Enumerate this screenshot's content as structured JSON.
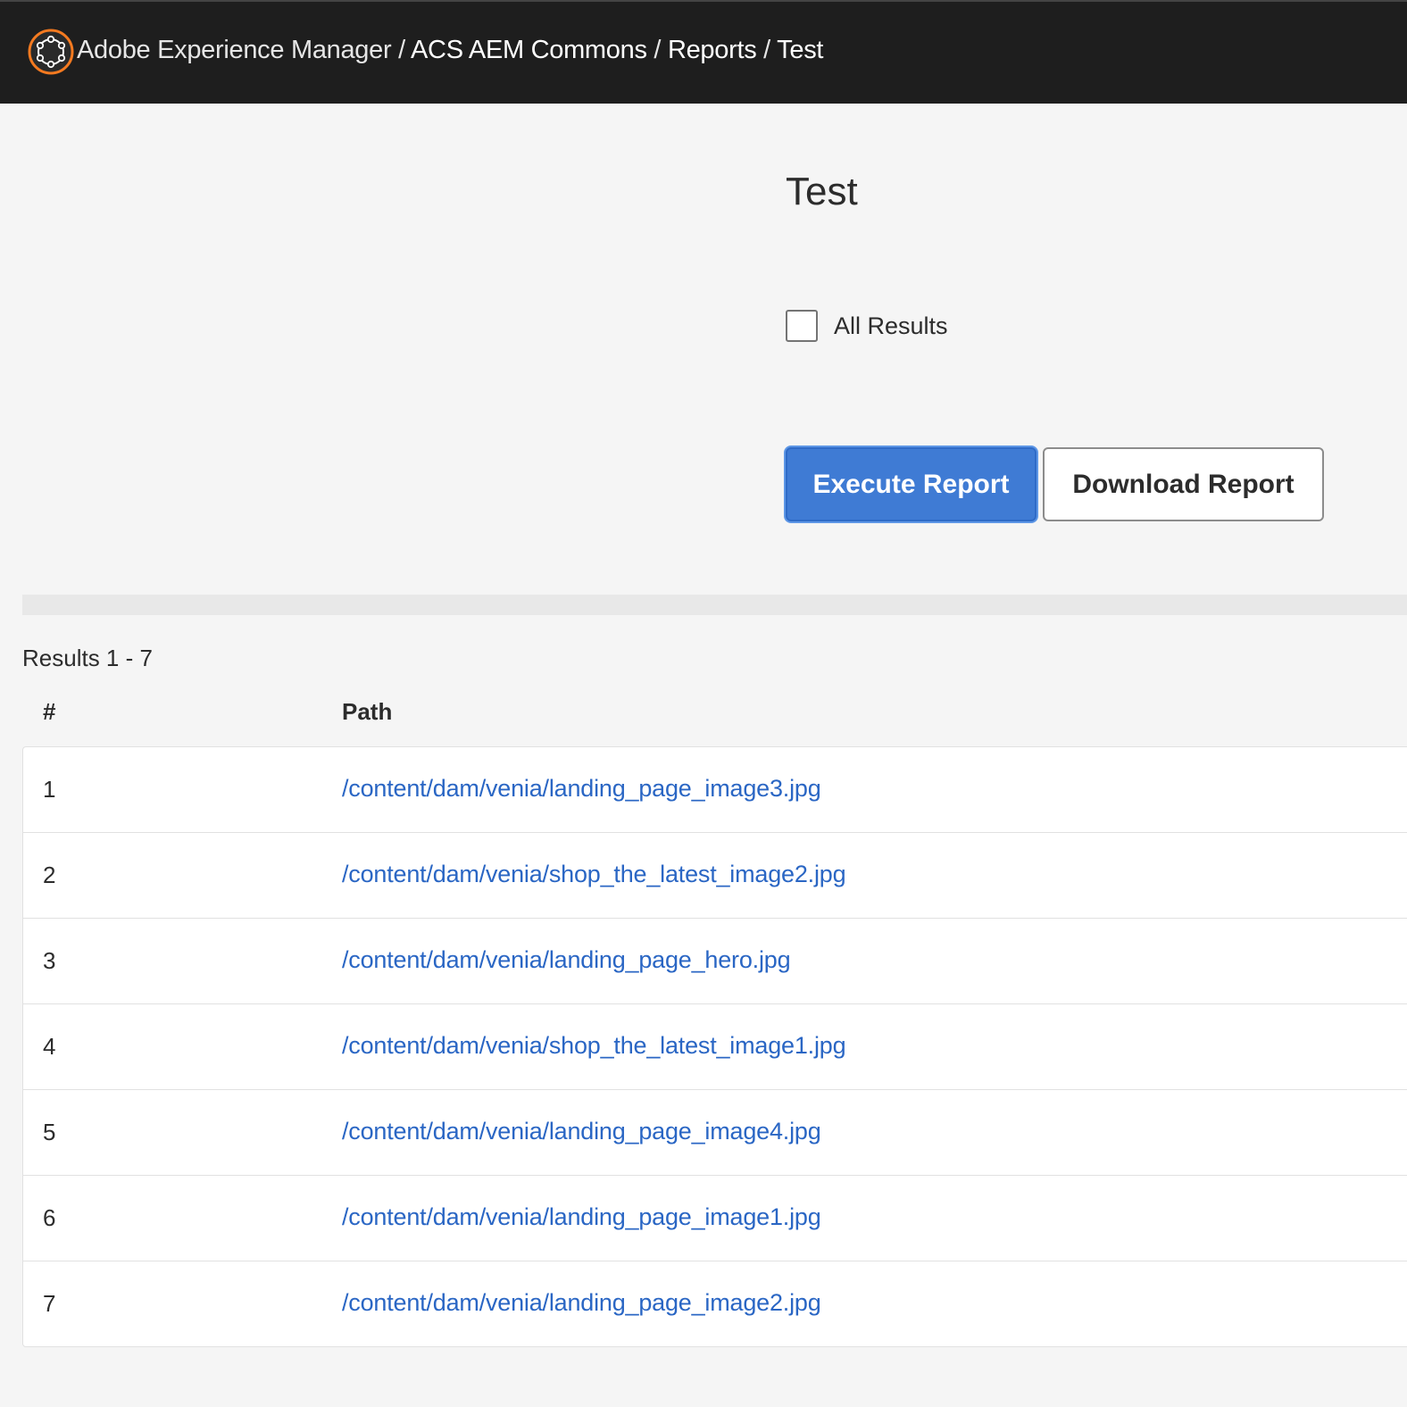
{
  "header": {
    "logo_icon": "adobe-experience-manager-logo",
    "breadcrumb": {
      "app": "Adobe Experience Manager",
      "sep": "/",
      "items": [
        "ACS AEM Commons",
        "Reports",
        "Test"
      ]
    }
  },
  "main": {
    "title": "Test",
    "all_results_label": "All Results",
    "all_results_checked": false,
    "execute_label": "Execute Report",
    "download_label": "Download Report"
  },
  "results": {
    "count_label": "Results 1 - 7",
    "columns": [
      "#",
      "Path"
    ],
    "rows": [
      {
        "num": "1",
        "path": "/content/dam/venia/landing_page_image3.jpg"
      },
      {
        "num": "2",
        "path": "/content/dam/venia/shop_the_latest_image2.jpg"
      },
      {
        "num": "3",
        "path": "/content/dam/venia/landing_page_hero.jpg"
      },
      {
        "num": "4",
        "path": "/content/dam/venia/shop_the_latest_image1.jpg"
      },
      {
        "num": "5",
        "path": "/content/dam/venia/landing_page_image4.jpg"
      },
      {
        "num": "6",
        "path": "/content/dam/venia/landing_page_image1.jpg"
      },
      {
        "num": "7",
        "path": "/content/dam/venia/landing_page_image2.jpg"
      }
    ]
  },
  "colors": {
    "header_bg": "#1e1e1e",
    "logo_accent": "#f47a20",
    "primary_button": "#3f7bd4",
    "link": "#2a66c4",
    "page_bg": "#f5f5f5"
  }
}
